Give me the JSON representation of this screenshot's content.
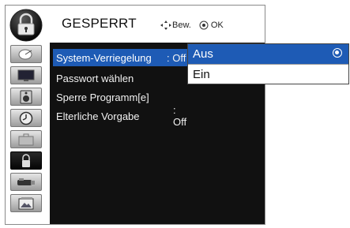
{
  "header": {
    "title": "GESPERRT",
    "hint_move": "Bew.",
    "hint_ok": "OK",
    "icon": "padlock-icon"
  },
  "sidebar": {
    "items": [
      {
        "name": "satellite-dish-icon"
      },
      {
        "name": "tv-screen-icon"
      },
      {
        "name": "speaker-icon"
      },
      {
        "name": "clock-icon"
      },
      {
        "name": "briefcase-icon"
      },
      {
        "name": "lock-icon",
        "active": true
      },
      {
        "name": "usb-stick-icon"
      },
      {
        "name": "photo-icon"
      }
    ]
  },
  "menu": {
    "items": [
      {
        "label": "System-Verriegelung",
        "value": ": Off"
      },
      {
        "label": "Passwort wählen",
        "value": ""
      },
      {
        "label": "Sperre Programm[e]",
        "value": ""
      },
      {
        "label": "Elterliche Vorgabe",
        "value": ": Off"
      }
    ]
  },
  "popup": {
    "options": [
      {
        "label": "Aus",
        "selected": true
      },
      {
        "label": "Ein",
        "selected": false
      }
    ]
  },
  "colors": {
    "highlight": "#1e5bb5",
    "panel": "#111111"
  }
}
